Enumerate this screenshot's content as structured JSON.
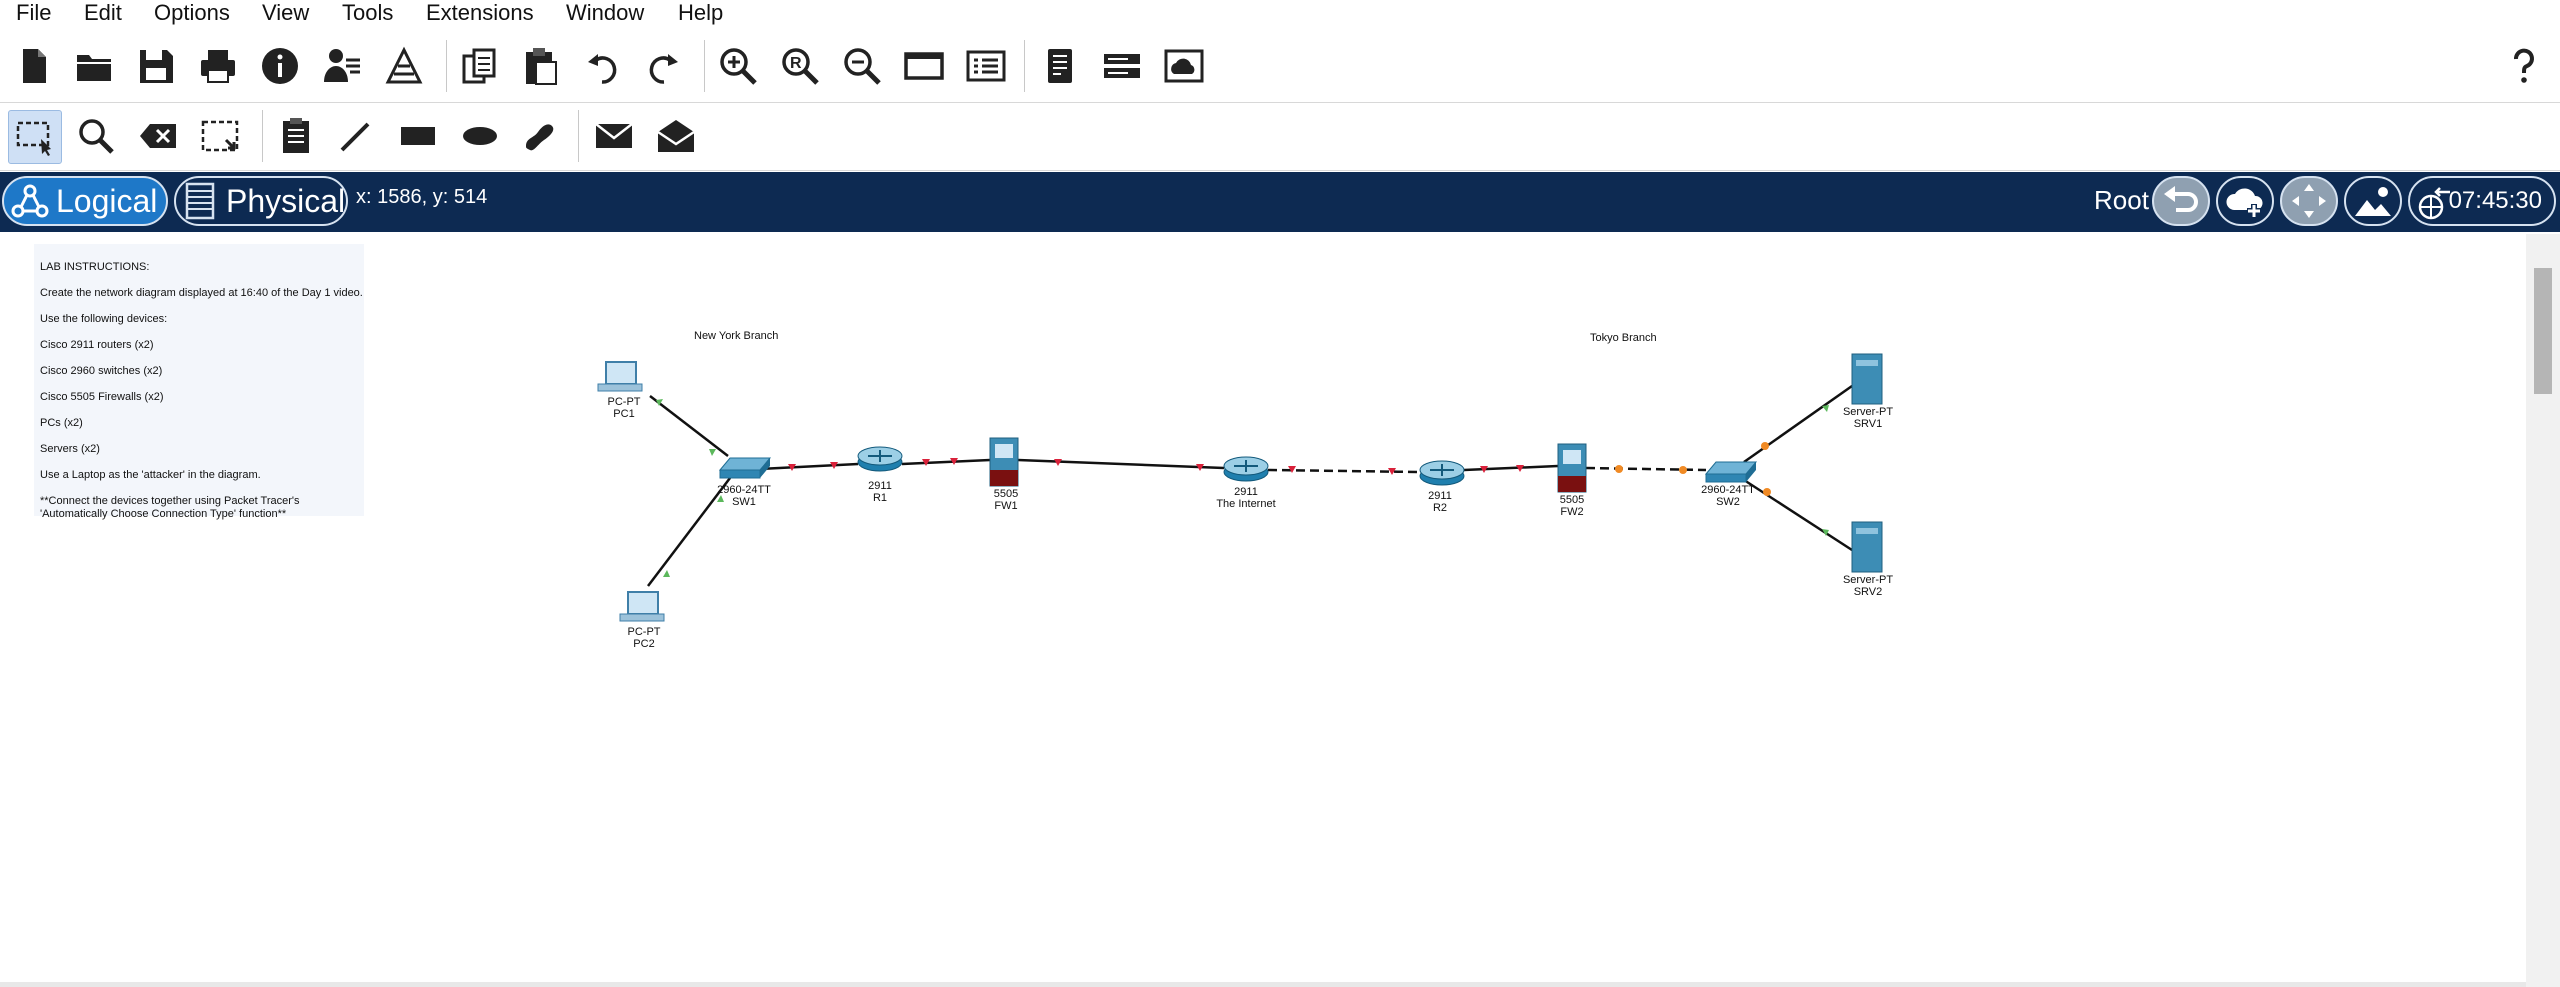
{
  "menu": [
    "File",
    "Edit",
    "Options",
    "View",
    "Tools",
    "Extensions",
    "Window",
    "Help"
  ],
  "toolbar_main": [
    {
      "name": "new-icon"
    },
    {
      "name": "open-icon"
    },
    {
      "name": "save-icon"
    },
    {
      "name": "print-icon"
    },
    {
      "name": "info-icon"
    },
    {
      "name": "user-profile-icon"
    },
    {
      "name": "network-activity-icon"
    },
    {
      "name": "copy-icon"
    },
    {
      "name": "paste-icon"
    },
    {
      "name": "undo-icon"
    },
    {
      "name": "redo-icon"
    },
    {
      "name": "zoom-in-icon"
    },
    {
      "name": "zoom-reset-icon"
    },
    {
      "name": "zoom-out-icon"
    },
    {
      "name": "window-icon"
    },
    {
      "name": "list-icon"
    },
    {
      "name": "palette-icon"
    },
    {
      "name": "device-icon"
    },
    {
      "name": "cloud-image-icon"
    },
    {
      "name": "help-icon"
    }
  ],
  "toolbar_edit": [
    {
      "name": "select-icon",
      "active": true
    },
    {
      "name": "inspect-icon"
    },
    {
      "name": "delete-icon"
    },
    {
      "name": "resize-icon"
    },
    {
      "name": "note-icon"
    },
    {
      "name": "line-icon"
    },
    {
      "name": "rectangle-icon"
    },
    {
      "name": "ellipse-icon"
    },
    {
      "name": "freeform-icon"
    },
    {
      "name": "simple-pdu-icon"
    },
    {
      "name": "complex-pdu-icon"
    }
  ],
  "modebar": {
    "logical": "Logical",
    "physical": "Physical",
    "coords": "x: 1586, y: 514",
    "root": "Root",
    "time": "07:45:30"
  },
  "note": [
    "LAB INSTRUCTIONS:",
    "Create the network diagram displayed at 16:40 of the Day 1 video.",
    "Use the following devices:",
    "Cisco 2911 routers (x2)",
    "Cisco 2960 switches (x2)",
    "Cisco 5505 Firewalls (x2)",
    "PCs (x2)",
    "Servers (x2)",
    "Use a Laptop as the 'attacker' in the diagram.",
    "**Connect the devices together using Packet Tracer's",
    "'Automatically Choose Connection Type' function**"
  ],
  "labels": {
    "ny": "New York Branch",
    "tokyo": "Tokyo Branch"
  },
  "devices": {
    "pc1": [
      "PC-PT",
      "PC1"
    ],
    "pc2": [
      "PC-PT",
      "PC2"
    ],
    "sw1": [
      "2960-24TT",
      "SW1"
    ],
    "r1": [
      "2911",
      "R1"
    ],
    "fw1": [
      "5505",
      "FW1"
    ],
    "inet": [
      "2911",
      "The Internet"
    ],
    "r2": [
      "2911",
      "R2"
    ],
    "fw2": [
      "5505",
      "FW2"
    ],
    "sw2": [
      "2960-24TT",
      "SW2"
    ],
    "srv1": [
      "Server-PT",
      "SRV1"
    ],
    "srv2": [
      "Server-PT",
      "SRV2"
    ]
  },
  "colors": {
    "link_up": "#5cb85c",
    "link_down": "#d9213a",
    "link_blocking": "#f08a24",
    "modebar": "#0d2a52",
    "logical_active": "#1e78c8"
  }
}
